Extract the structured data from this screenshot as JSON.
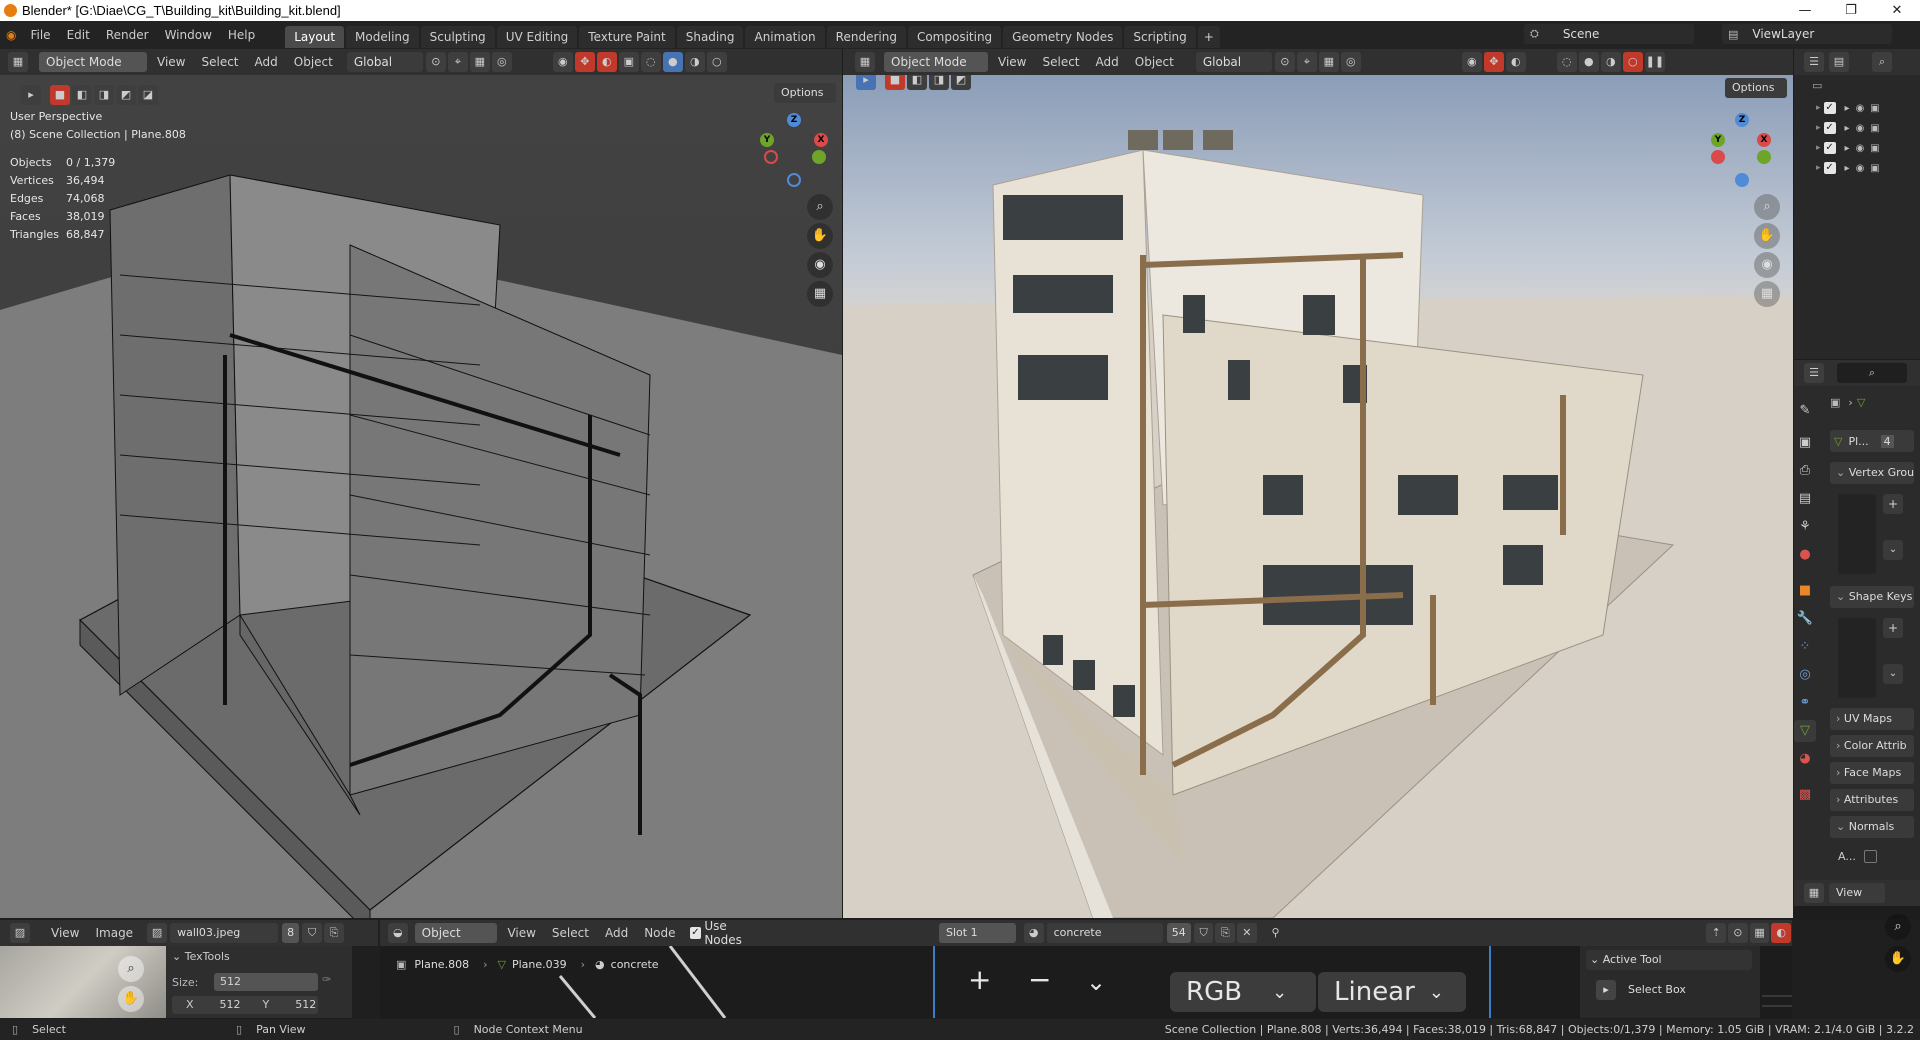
{
  "window": {
    "title": "Blender* [G:\\Diae\\CG_T\\Building_kit\\Building_kit.blend]",
    "minimize": "—",
    "maximize": "❐",
    "close": "✕"
  },
  "menubar": {
    "menus": [
      "File",
      "Edit",
      "Render",
      "Window",
      "Help"
    ],
    "workspaces": [
      "Layout",
      "Modeling",
      "Sculpting",
      "UV Editing",
      "Texture Paint",
      "Shading",
      "Animation",
      "Rendering",
      "Compositing",
      "Geometry Nodes",
      "Scripting"
    ],
    "active_workspace": "Layout",
    "scene": "Scene",
    "view_layer": "ViewLayer"
  },
  "left_viewport": {
    "mode": "Object Mode",
    "menus": [
      "View",
      "Select",
      "Add",
      "Object"
    ],
    "orientation": "Global",
    "options": "Options",
    "perspective": "User Perspective",
    "collection": "(8) Scene Collection | Plane.808",
    "stats": [
      {
        "label": "Objects",
        "value": "0 / 1,379"
      },
      {
        "label": "Vertices",
        "value": "36,494"
      },
      {
        "label": "Edges",
        "value": "74,068"
      },
      {
        "label": "Faces",
        "value": "38,019"
      },
      {
        "label": "Triangles",
        "value": "68,847"
      }
    ]
  },
  "right_viewport": {
    "mode": "Object Mode",
    "menus": [
      "View",
      "Select",
      "Add",
      "Object"
    ],
    "orientation": "Global",
    "options": "Options"
  },
  "gizmo": {
    "z": "Z",
    "y": "Y",
    "x": "X"
  },
  "properties": {
    "object_name": "Pl...",
    "users": "4",
    "sections": [
      "Vertex Grou",
      "Shape Keys",
      "UV Maps",
      "Color Attrib",
      "Face Maps",
      "Attributes",
      "Normals"
    ],
    "auto_label": "A..."
  },
  "image_editor": {
    "menus": [
      "View",
      "Image"
    ],
    "image_name": "wall03.jpeg",
    "users": "8",
    "textools_title": "TexTools",
    "size_label": "Size:",
    "size_value": "512",
    "x_label": "X",
    "x_value": "512",
    "y_label": "Y",
    "y_value": "512"
  },
  "node_editor": {
    "type": "Object",
    "menus": [
      "View",
      "Select",
      "Add",
      "Node"
    ],
    "use_nodes": "Use Nodes",
    "slot": "Slot 1",
    "material": "concrete",
    "material_users": "54",
    "breadcrumb": [
      "Plane.808",
      "Plane.039",
      "concrete"
    ],
    "color_space": "RGB",
    "interpolation": "Linear",
    "active_tool_title": "Active Tool",
    "active_tool": "Select Box",
    "view_label": "View"
  },
  "statusbar": {
    "select": "Select",
    "pan": "Pan View",
    "context": "Node Context Menu",
    "info": "Scene Collection | Plane.808 | Verts:36,494 | Faces:38,019 | Tris:68,847 | Objects:0/1,379 | Memory: 1.05 GiB | VRAM: 2.1/4.0 GiB | 3.2.2"
  }
}
